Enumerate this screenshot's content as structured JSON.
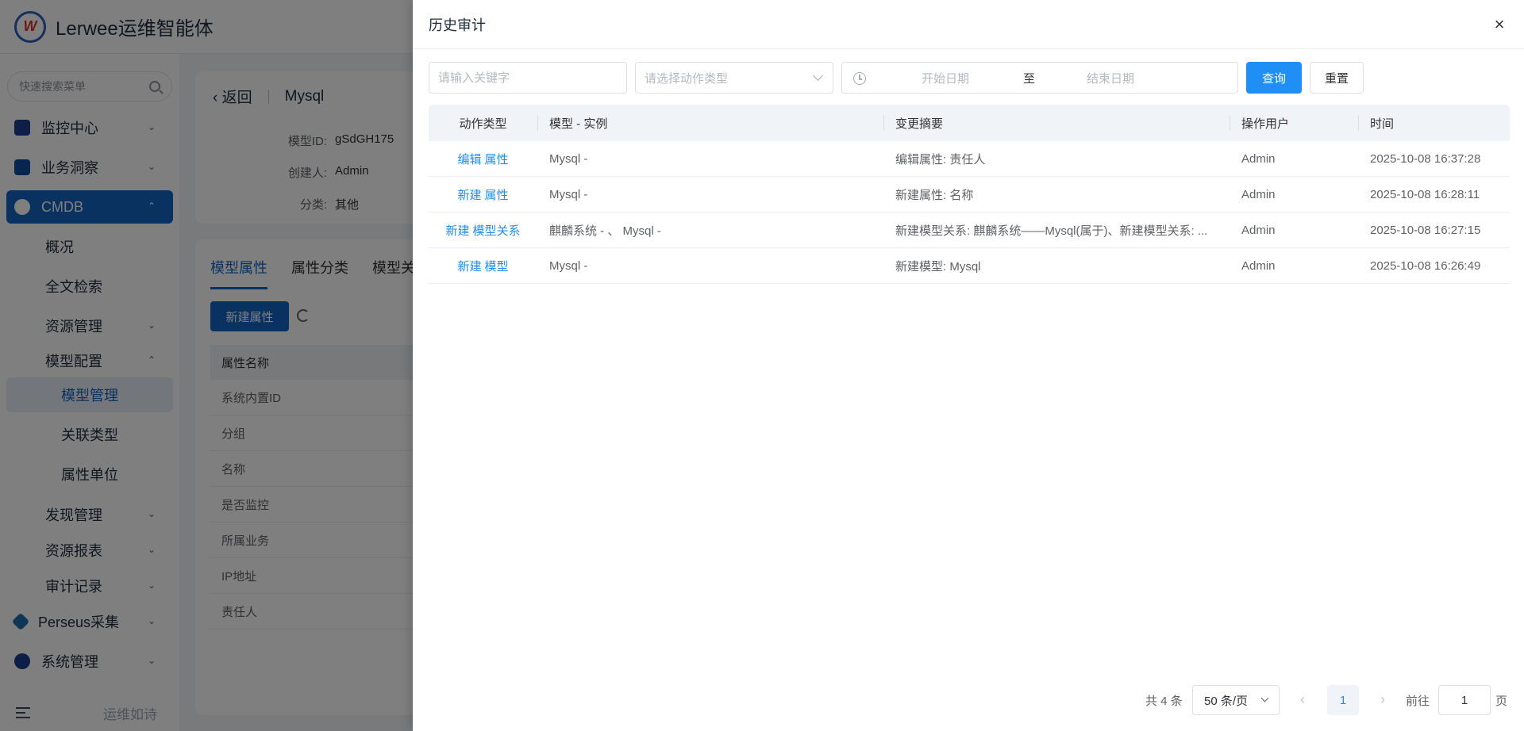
{
  "app": {
    "title": "Lerwee运维智能体"
  },
  "sidebar": {
    "search_placeholder": "快速搜索菜单",
    "items": [
      {
        "label": "监控中心"
      },
      {
        "label": "业务洞察"
      },
      {
        "label": "CMDB"
      },
      {
        "label": "概况"
      },
      {
        "label": "全文检索"
      },
      {
        "label": "资源管理"
      },
      {
        "label": "模型配置"
      },
      {
        "label": "模型管理"
      },
      {
        "label": "关联类型"
      },
      {
        "label": "属性单位"
      },
      {
        "label": "发现管理"
      },
      {
        "label": "资源报表"
      },
      {
        "label": "审计记录"
      },
      {
        "label": "Perseus采集"
      },
      {
        "label": "系统管理"
      }
    ],
    "footer": "运维如诗"
  },
  "detail": {
    "back_label": "返回",
    "model_name": "Mysql",
    "meta": [
      {
        "key": "模型ID:",
        "value": "gSdGH175"
      },
      {
        "key": "创建人:",
        "value": "Admin"
      },
      {
        "key": "分类:",
        "value": "其他"
      }
    ],
    "tabs": [
      "模型属性",
      "属性分类",
      "模型关"
    ],
    "new_attr_label": "新建属性",
    "table_header": "属性名称",
    "rows": [
      "系统内置ID",
      "分组",
      "名称",
      "是否监控",
      "所属业务",
      "IP地址",
      "责任人"
    ]
  },
  "drawer": {
    "title": "历史审计",
    "close": "×",
    "filters": {
      "keyword_placeholder": "请输入关键字",
      "action_placeholder": "请选择动作类型",
      "date_start_placeholder": "开始日期",
      "date_separator": "至",
      "date_end_placeholder": "结束日期",
      "query_label": "查询",
      "reset_label": "重置"
    },
    "columns": [
      "动作类型",
      "模型 - 实例",
      "变更摘要",
      "操作用户",
      "时间"
    ],
    "rows": [
      {
        "action_verb": "编辑",
        "action_obj": "属性",
        "instance": "Mysql -",
        "summary": "编辑属性: 责任人",
        "user": "Admin",
        "time": "2025-10-08 16:37:28"
      },
      {
        "action_verb": "新建",
        "action_obj": "属性",
        "instance": "Mysql -",
        "summary": "新建属性: 名称",
        "user": "Admin",
        "time": "2025-10-08 16:28:11"
      },
      {
        "action_verb": "新建",
        "action_obj": "模型关系",
        "instance": "麒麟系统 - 、 Mysql -",
        "summary": "新建模型关系: 麒麟系统——Mysql(属于)、新建模型关系: ...",
        "user": "Admin",
        "time": "2025-10-08 16:27:15"
      },
      {
        "action_verb": "新建",
        "action_obj": "模型",
        "instance": "Mysql -",
        "summary": "新建模型: Mysql",
        "user": "Admin",
        "time": "2025-10-08 16:26:49"
      }
    ],
    "pagination": {
      "total": "共 4 条",
      "page_size": "50 条/页",
      "current_page": "1",
      "goto_label": "前往",
      "goto_value": "1",
      "page_suffix": "页"
    }
  },
  "colors": {
    "primary": "#1f8ff5",
    "brand": "#1565c0",
    "overlay": "rgba(0,0,0,0.5)"
  }
}
